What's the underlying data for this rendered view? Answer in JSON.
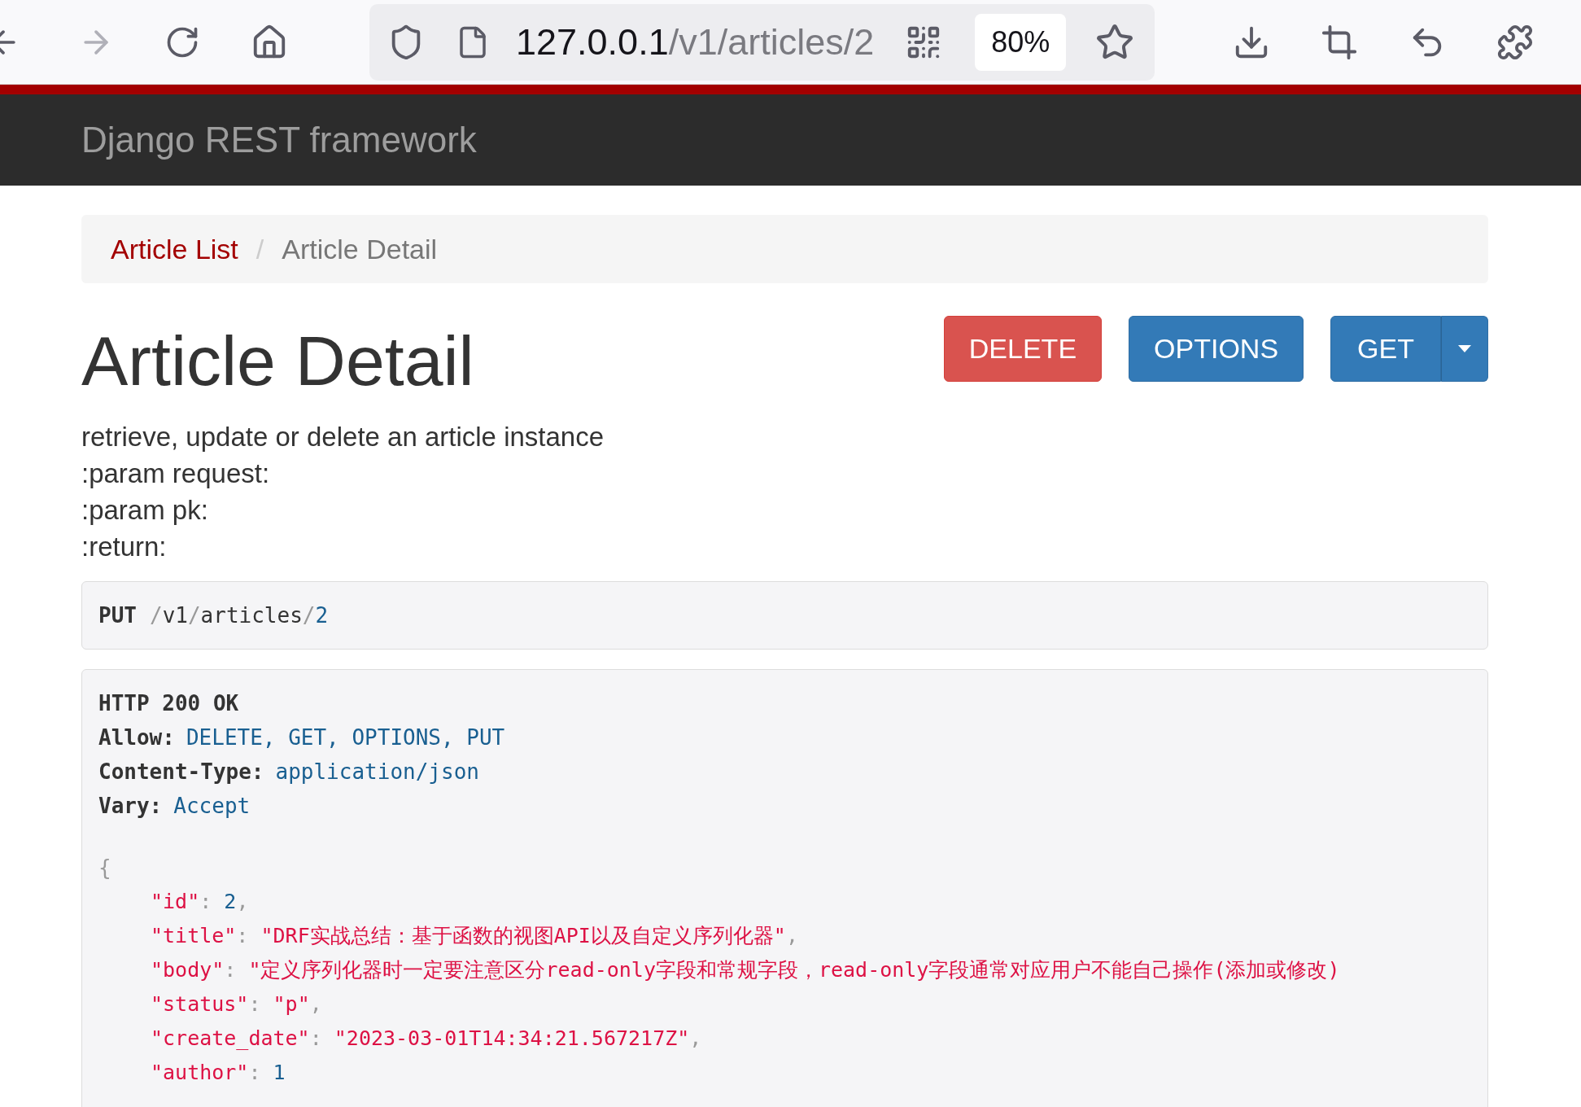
{
  "browser": {
    "url_host": "127.0.0.1",
    "url_path": "/v1/articles/2",
    "zoom": "80%"
  },
  "navbar": {
    "brand": "Django REST framework"
  },
  "breadcrumbs": {
    "divider": "/",
    "items": [
      {
        "label": "Article List",
        "selected": false
      },
      {
        "label": "Article Detail",
        "selected": true
      }
    ]
  },
  "title": "Article Detail",
  "buttons": [
    {
      "label": "DELETE",
      "kind": "danger"
    },
    {
      "label": "OPTIONS",
      "kind": "primary"
    },
    {
      "label": "GET",
      "kind": "split"
    }
  ],
  "description": [
    "retrieve, update or delete an article instance",
    ":param request:",
    ":param pk:",
    ":return:"
  ],
  "request": {
    "method": "PUT",
    "path": [
      {
        "text": "/",
        "kind": "sep"
      },
      {
        "text": "v1",
        "kind": "seg"
      },
      {
        "text": "/",
        "kind": "sep"
      },
      {
        "text": "articles",
        "kind": "seg"
      },
      {
        "text": "/",
        "kind": "sep"
      },
      {
        "text": "2",
        "kind": "num"
      }
    ]
  },
  "response": {
    "status": "HTTP 200 OK",
    "headers": [
      {
        "name": "Allow:",
        "value": "DELETE, GET, OPTIONS, PUT"
      },
      {
        "name": "Content-Type:",
        "value": "application/json"
      },
      {
        "name": "Vary:",
        "value": "Accept"
      }
    ],
    "open": "{",
    "fields": [
      {
        "key": "\"id\"",
        "sep": ":",
        "value": "2",
        "end": ",",
        "kind": "number"
      },
      {
        "key": "\"title\"",
        "sep": ":",
        "value": "\"DRF实战总结：基于函数的视图API以及自定义序列化器\"",
        "end": ",",
        "kind": "string"
      },
      {
        "key": "\"body\"",
        "sep": ":",
        "value": "\"定义序列化器时一定要注意区分read-only字段和常规字段，read-only字段通常对应用户不能自己操作(添加或修改)",
        "kind": "string"
      },
      {
        "key": "\"status\"",
        "sep": ":",
        "value": "\"p\"",
        "end": ",",
        "kind": "string"
      },
      {
        "key": "\"create_date\"",
        "sep": ":",
        "value": "\"2023-03-01T14:34:21.567217Z\"",
        "end": ",",
        "kind": "string"
      },
      {
        "key": "\"author\"",
        "sep": ":",
        "value": "1",
        "kind": "number"
      }
    ]
  }
}
